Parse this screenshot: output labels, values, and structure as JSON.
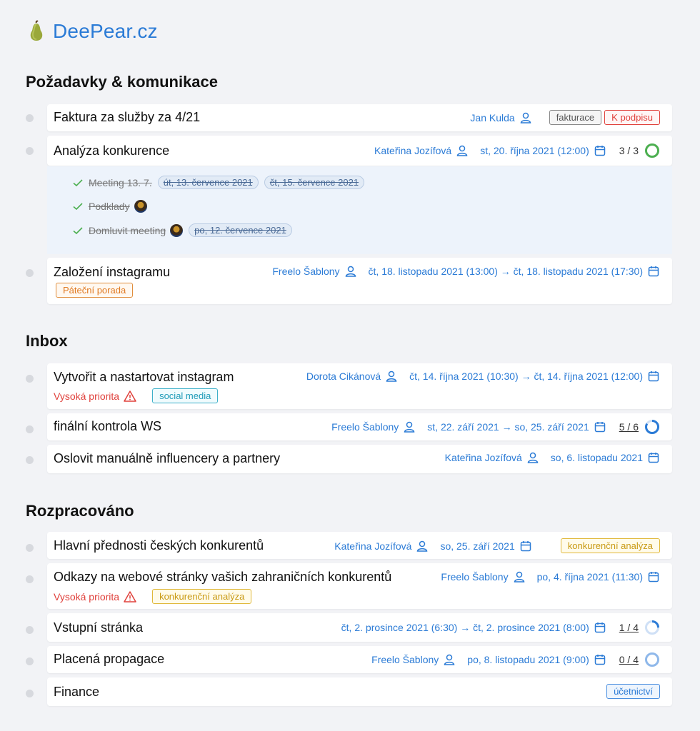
{
  "brand": {
    "name": "DeePear.cz"
  },
  "sections": [
    {
      "title": "Požadavky & komunikace",
      "tasks": [
        {
          "title": "Faktura za služby za 4/21",
          "assignee": "Jan Kulda",
          "tags": [
            "fakturace",
            "K podpisu"
          ]
        },
        {
          "title": "Analýza konkurence",
          "assignee": "Kateřina Jozífová",
          "date": "st, 20. října 2021 (12:00)",
          "count": "3 / 3",
          "progress": 1.0,
          "subtasks": [
            {
              "title": "Meeting 13. 7.",
              "dates": [
                "út, 13. července 2021",
                "čt, 15. července 2021"
              ]
            },
            {
              "title": "Podklady"
            },
            {
              "title": "Domluvit meeting",
              "dates": [
                "po, 12. července 2021"
              ]
            }
          ]
        },
        {
          "title": "Založení instagramu",
          "assignee": "Freelo Šablony",
          "date": "čt, 18. listopadu 2021 (13:00) → čt, 18. listopadu 2021 (17:30)",
          "tags": [
            "Páteční porada"
          ]
        }
      ]
    },
    {
      "title": "Inbox",
      "tasks": [
        {
          "title": "Vytvořit a nastartovat instagram",
          "assignee": "Dorota Cikánová",
          "date": "čt, 14. října 2021 (10:30) → čt, 14. října 2021 (12:00)",
          "priority": "Vysoká priorita",
          "tags": [
            "social media"
          ]
        },
        {
          "title": "finální kontrola WS",
          "assignee": "Freelo Šablony",
          "date": "st, 22. září 2021 → so, 25. září 2021",
          "count": "5 / 6",
          "progress": 0.83
        },
        {
          "title": "Oslovit manuálně influencery a partnery",
          "assignee": "Kateřina Jozífová",
          "date": "so, 6. listopadu 2021"
        }
      ]
    },
    {
      "title": "Rozpracováno",
      "tasks": [
        {
          "title": "Hlavní přednosti českých konkurentů",
          "assignee": "Kateřina Jozífová",
          "date": "so, 25. září 2021",
          "tags": [
            "konkurenční analýza"
          ]
        },
        {
          "title": "Odkazy na webové stránky vašich zahraničních konkurentů",
          "assignee": "Freelo Šablony",
          "date": "po, 4. října 2021 (11:30)",
          "priority": "Vysoká priorita",
          "tags": [
            "konkurenční analýza"
          ]
        },
        {
          "title": "Vstupní stránka",
          "date": "čt, 2. prosince 2021 (6:30) → čt, 2. prosince 2021 (8:00)",
          "count": "1 / 4",
          "progress": 0.25
        },
        {
          "title": "Placená propagace",
          "assignee": "Freelo Šablony",
          "date": "po, 8. listopadu 2021 (9:00)",
          "count": "0 / 4",
          "progress": 0.0
        },
        {
          "title": "Finance",
          "tags": [
            "účetnictví"
          ]
        }
      ]
    }
  ],
  "colors": {
    "accent": "#2b7bd6",
    "danger": "#e0403b",
    "done": "#4caf50"
  }
}
